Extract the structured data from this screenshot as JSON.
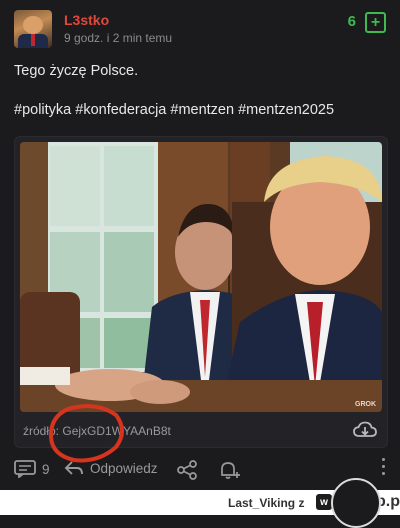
{
  "post": {
    "username": "L3stko",
    "time": "9 godz. i 2 min temu",
    "votes": "6",
    "plus_label": "+",
    "body": "Tego życzę Polsce.",
    "tags": "#polityka #konfederacja #mentzen #mentzen2025"
  },
  "embed": {
    "photo_badge": "GROK",
    "source_label": "źródło:",
    "source_value": "GejxGD1WYAAnB8t"
  },
  "actions": {
    "comments_count": "9",
    "reply_label": "Odpowiedz"
  },
  "watermark": {
    "user": "Last_Viking z",
    "logo": "w",
    "site": "wykop.pl"
  },
  "colors": {
    "username": "#e0483b",
    "votes": "#3fb950",
    "highlight": "#d6341f",
    "background": "#1b1b1d"
  }
}
